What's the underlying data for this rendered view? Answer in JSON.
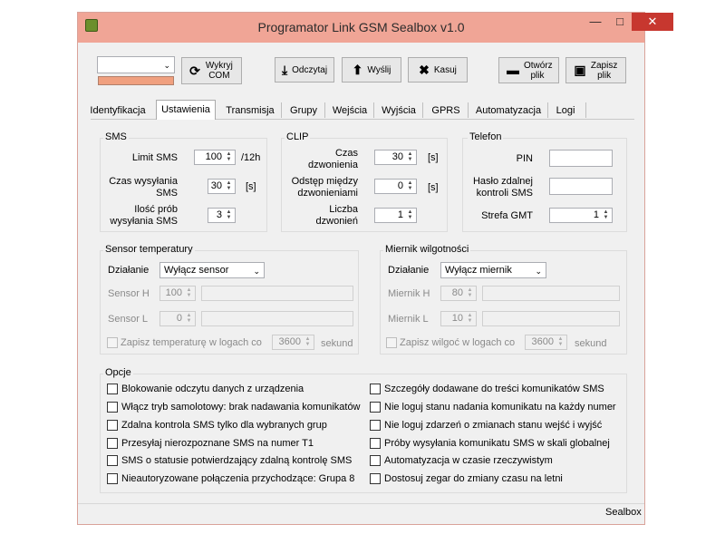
{
  "window": {
    "title": "Programator Link GSM Sealbox v1.0",
    "minimize": "—",
    "maximize": "□",
    "close": "✕"
  },
  "toolbar": {
    "com_port_value": "",
    "detect_com": "Wykryj COM",
    "read": "Odczytaj",
    "send": "Wyślij",
    "delete": "Kasuj",
    "open_file": "Otwórz plik",
    "save_file": "Zapisz plik",
    "status_color": "#f0a07f"
  },
  "tabs": [
    "Identyfikacja",
    "Ustawienia",
    "Transmisja",
    "Grupy",
    "Wejścia",
    "Wyjścia",
    "GPRS",
    "Automatyzacja",
    "Logi"
  ],
  "active_tab": "Ustawienia",
  "sms": {
    "title": "SMS",
    "limit_label": "Limit SMS",
    "limit_value": "100",
    "limit_unit": "/12h",
    "send_time_label": "Czas wysyłania SMS",
    "send_time_value": "30",
    "send_time_unit": "[s]",
    "tries_label": "Ilość prób wysyłania SMS",
    "tries_value": "3"
  },
  "clip": {
    "title": "CLIP",
    "ring_time_label": "Czas dzwonienia",
    "ring_time_value": "30",
    "ring_time_unit": "[s]",
    "gap_label": "Odstęp między dzwonieniami",
    "gap_value": "0",
    "gap_unit": "[s]",
    "count_label": "Liczba dzwonień",
    "count_value": "1"
  },
  "phone": {
    "title": "Telefon",
    "pin_label": "PIN",
    "pin_value": "",
    "remote_pass_label": "Hasło zdalnej kontroli SMS",
    "remote_pass_value": "",
    "gmt_label": "Strefa GMT",
    "gmt_value": "1"
  },
  "temp_sensor": {
    "title": "Sensor temperatury",
    "action_label": "Działanie",
    "action_value": "Wyłącz sensor",
    "h_label": "Sensor H",
    "h_value": "100",
    "l_label": "Sensor L",
    "l_value": "0",
    "log_label": "Zapisz temperaturę w logach co",
    "log_value": "3600",
    "log_unit": "sekund"
  },
  "humidity": {
    "title": "Miernik wilgotności",
    "action_label": "Działanie",
    "action_value": "Wyłącz miernik",
    "h_label": "Miernik H",
    "h_value": "80",
    "l_label": "Miernik L",
    "l_value": "10",
    "log_label": "Zapisz wilgoć w logach co",
    "log_value": "3600",
    "log_unit": "sekund"
  },
  "options": {
    "title": "Opcje",
    "left": [
      "Blokowanie odczytu danych z urządzenia",
      "Włącz tryb samolotowy: brak nadawania komunikatów",
      "Zdalna kontrola SMS tylko dla wybranych grup",
      "Przesyłaj nierozpoznane SMS na numer T1",
      "SMS o statusie potwierdzający zdalną kontrolę SMS",
      "Nieautoryzowane połączenia przychodzące: Grupa 8"
    ],
    "right": [
      "Szczegóły dodawane do treści komunikatów SMS",
      "Nie loguj stanu nadania komunikatu na każdy numer",
      "Nie loguj zdarzeń o zmianach stanu wejść i wyjść",
      "Próby wysyłania komunikatu SMS w skali globalnej",
      "Automatyzacja w czasie rzeczywistym",
      "Dostosuj zegar do zmiany czasu na letni"
    ]
  },
  "statusbar": {
    "text": "Sealbox"
  },
  "colors": {
    "titlebar": "#f0a596",
    "close": "#c7372f",
    "status_indicator": "#f0a07f"
  }
}
